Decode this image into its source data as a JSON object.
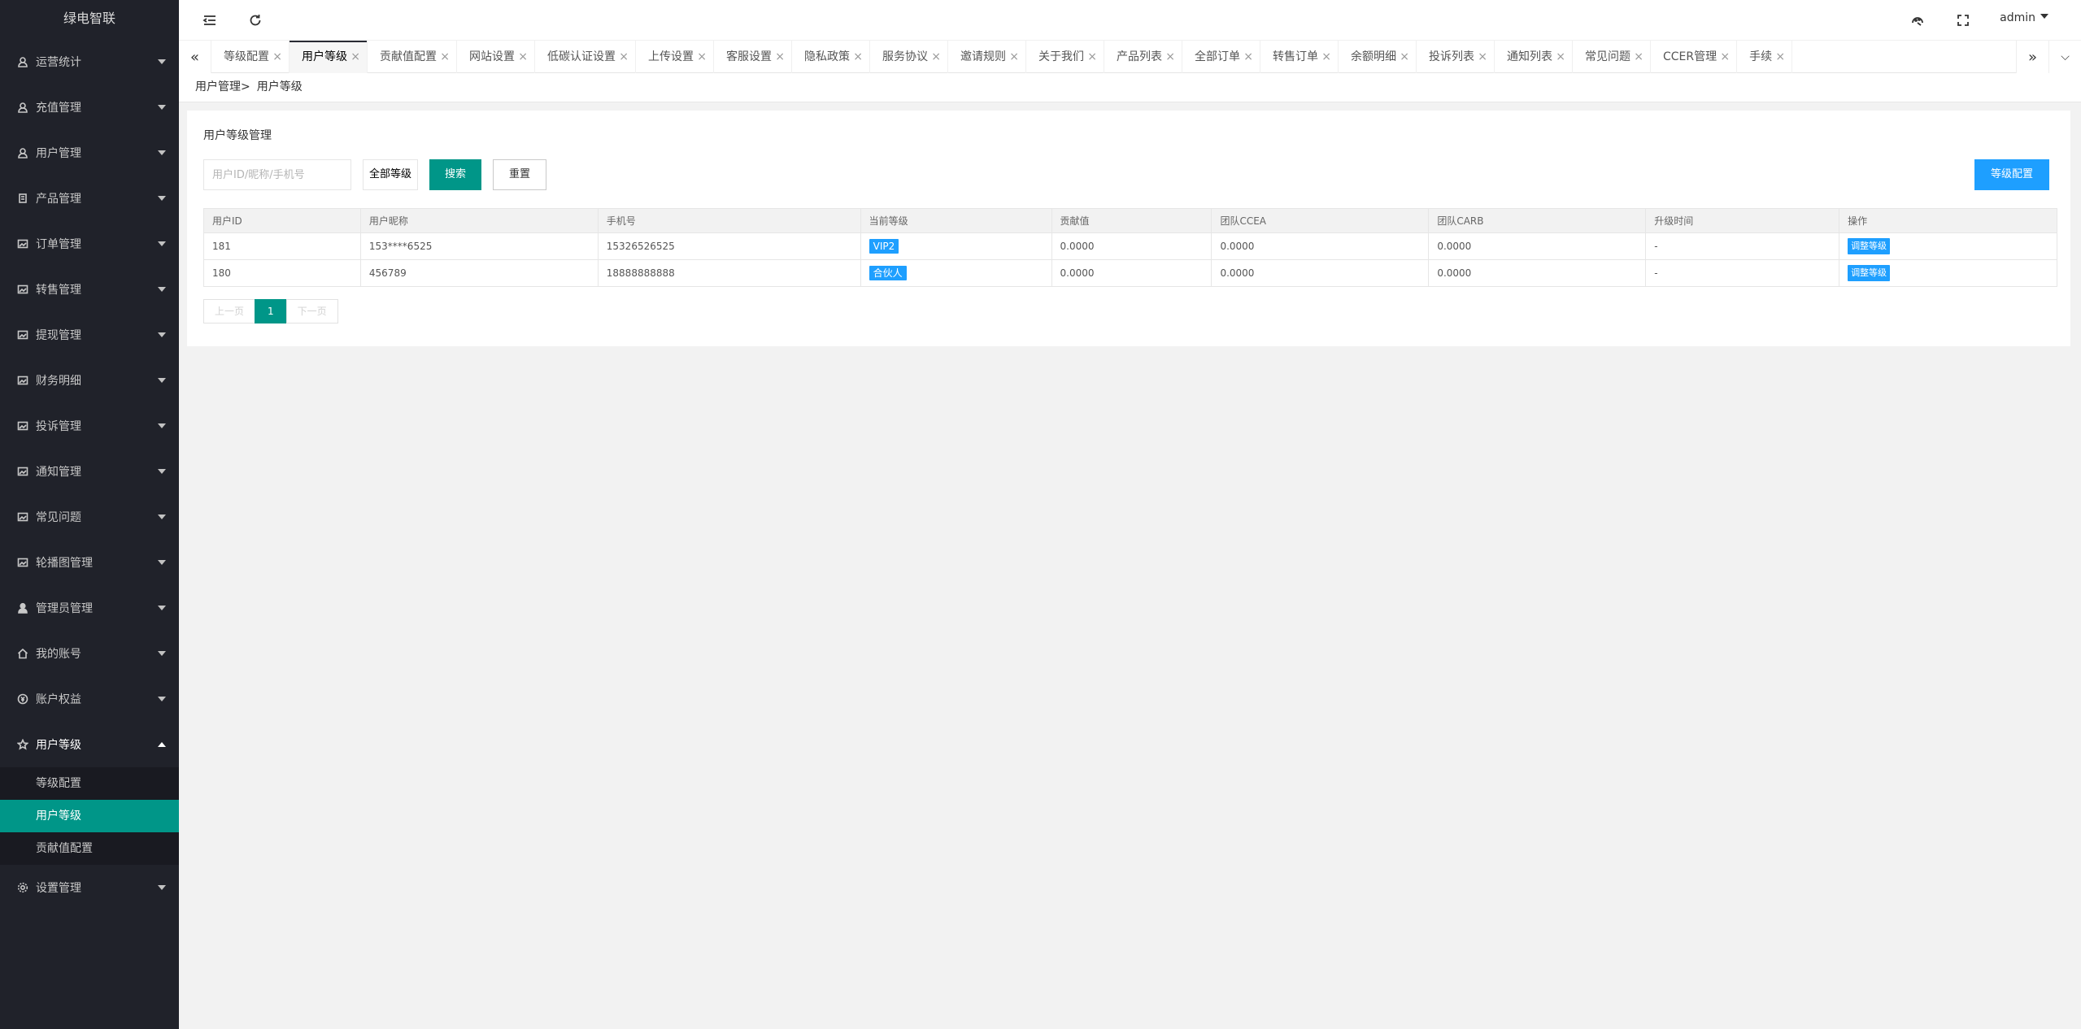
{
  "app": {
    "title": "绿电智联"
  },
  "sidebar": {
    "items": [
      {
        "label": "运营统计",
        "icon": "dashboard-icon"
      },
      {
        "label": "充值管理",
        "icon": "recharge-icon"
      },
      {
        "label": "用户管理",
        "icon": "user-icon"
      },
      {
        "label": "产品管理",
        "icon": "product-icon"
      },
      {
        "label": "订单管理",
        "icon": "order-icon"
      },
      {
        "label": "转售管理",
        "icon": "resale-icon"
      },
      {
        "label": "提现管理",
        "icon": "withdraw-icon"
      },
      {
        "label": "财务明细",
        "icon": "finance-icon"
      },
      {
        "label": "投诉管理",
        "icon": "complaint-icon"
      },
      {
        "label": "通知管理",
        "icon": "notice-icon"
      },
      {
        "label": "常见问题",
        "icon": "faq-icon"
      },
      {
        "label": "轮播图管理",
        "icon": "carousel-icon"
      },
      {
        "label": "管理员管理",
        "icon": "admin-icon"
      },
      {
        "label": "我的账号",
        "icon": "home-icon"
      },
      {
        "label": "账户权益",
        "icon": "rights-icon"
      },
      {
        "label": "用户等级",
        "icon": "star-icon"
      }
    ],
    "submenu": [
      {
        "label": "等级配置"
      },
      {
        "label": "用户等级"
      },
      {
        "label": "贡献值配置"
      }
    ],
    "last_item": {
      "label": "设置管理",
      "icon": "settings-icon"
    }
  },
  "header": {
    "user": "admin"
  },
  "tabs": [
    "等级配置",
    "用户等级",
    "贡献值配置",
    "网站设置",
    "低碳认证设置",
    "上传设置",
    "客服设置",
    "隐私政策",
    "服务协议",
    "邀请规则",
    "关于我们",
    "产品列表",
    "全部订单",
    "转售订单",
    "余额明细",
    "投诉列表",
    "通知列表",
    "常见问题",
    "CCER管理",
    "手续"
  ],
  "breadcrumb": {
    "parent": "用户管理>",
    "current": "用户等级"
  },
  "panel": {
    "title": "用户等级管理",
    "search_placeholder": "用户ID/昵称/手机号",
    "level_select": "全部等级",
    "search_label": "搜索",
    "reset_label": "重置",
    "config_label": "等级配置"
  },
  "table": {
    "headers": [
      "用户ID",
      "用户昵称",
      "手机号",
      "当前等级",
      "贡献值",
      "团队CCEA",
      "团队CARB",
      "升级时间",
      "操作"
    ],
    "rows": [
      {
        "id": "181",
        "nickname": "153****6525",
        "phone": "15326526525",
        "level": "VIP2",
        "contribution": "0.0000",
        "ccea": "0.0000",
        "carb": "0.0000",
        "upgrade_time": "-",
        "action": "调整等级"
      },
      {
        "id": "180",
        "nickname": "456789",
        "phone": "18888888888",
        "level": "合伙人",
        "contribution": "0.0000",
        "ccea": "0.0000",
        "carb": "0.0000",
        "upgrade_time": "-",
        "action": "调整等级"
      }
    ]
  },
  "pager": {
    "prev": "上一页",
    "current": "1",
    "next": "下一页"
  },
  "colors": {
    "sidebar_bg": "#20222a",
    "accent": "#009688",
    "primary": "#1e9fff"
  }
}
